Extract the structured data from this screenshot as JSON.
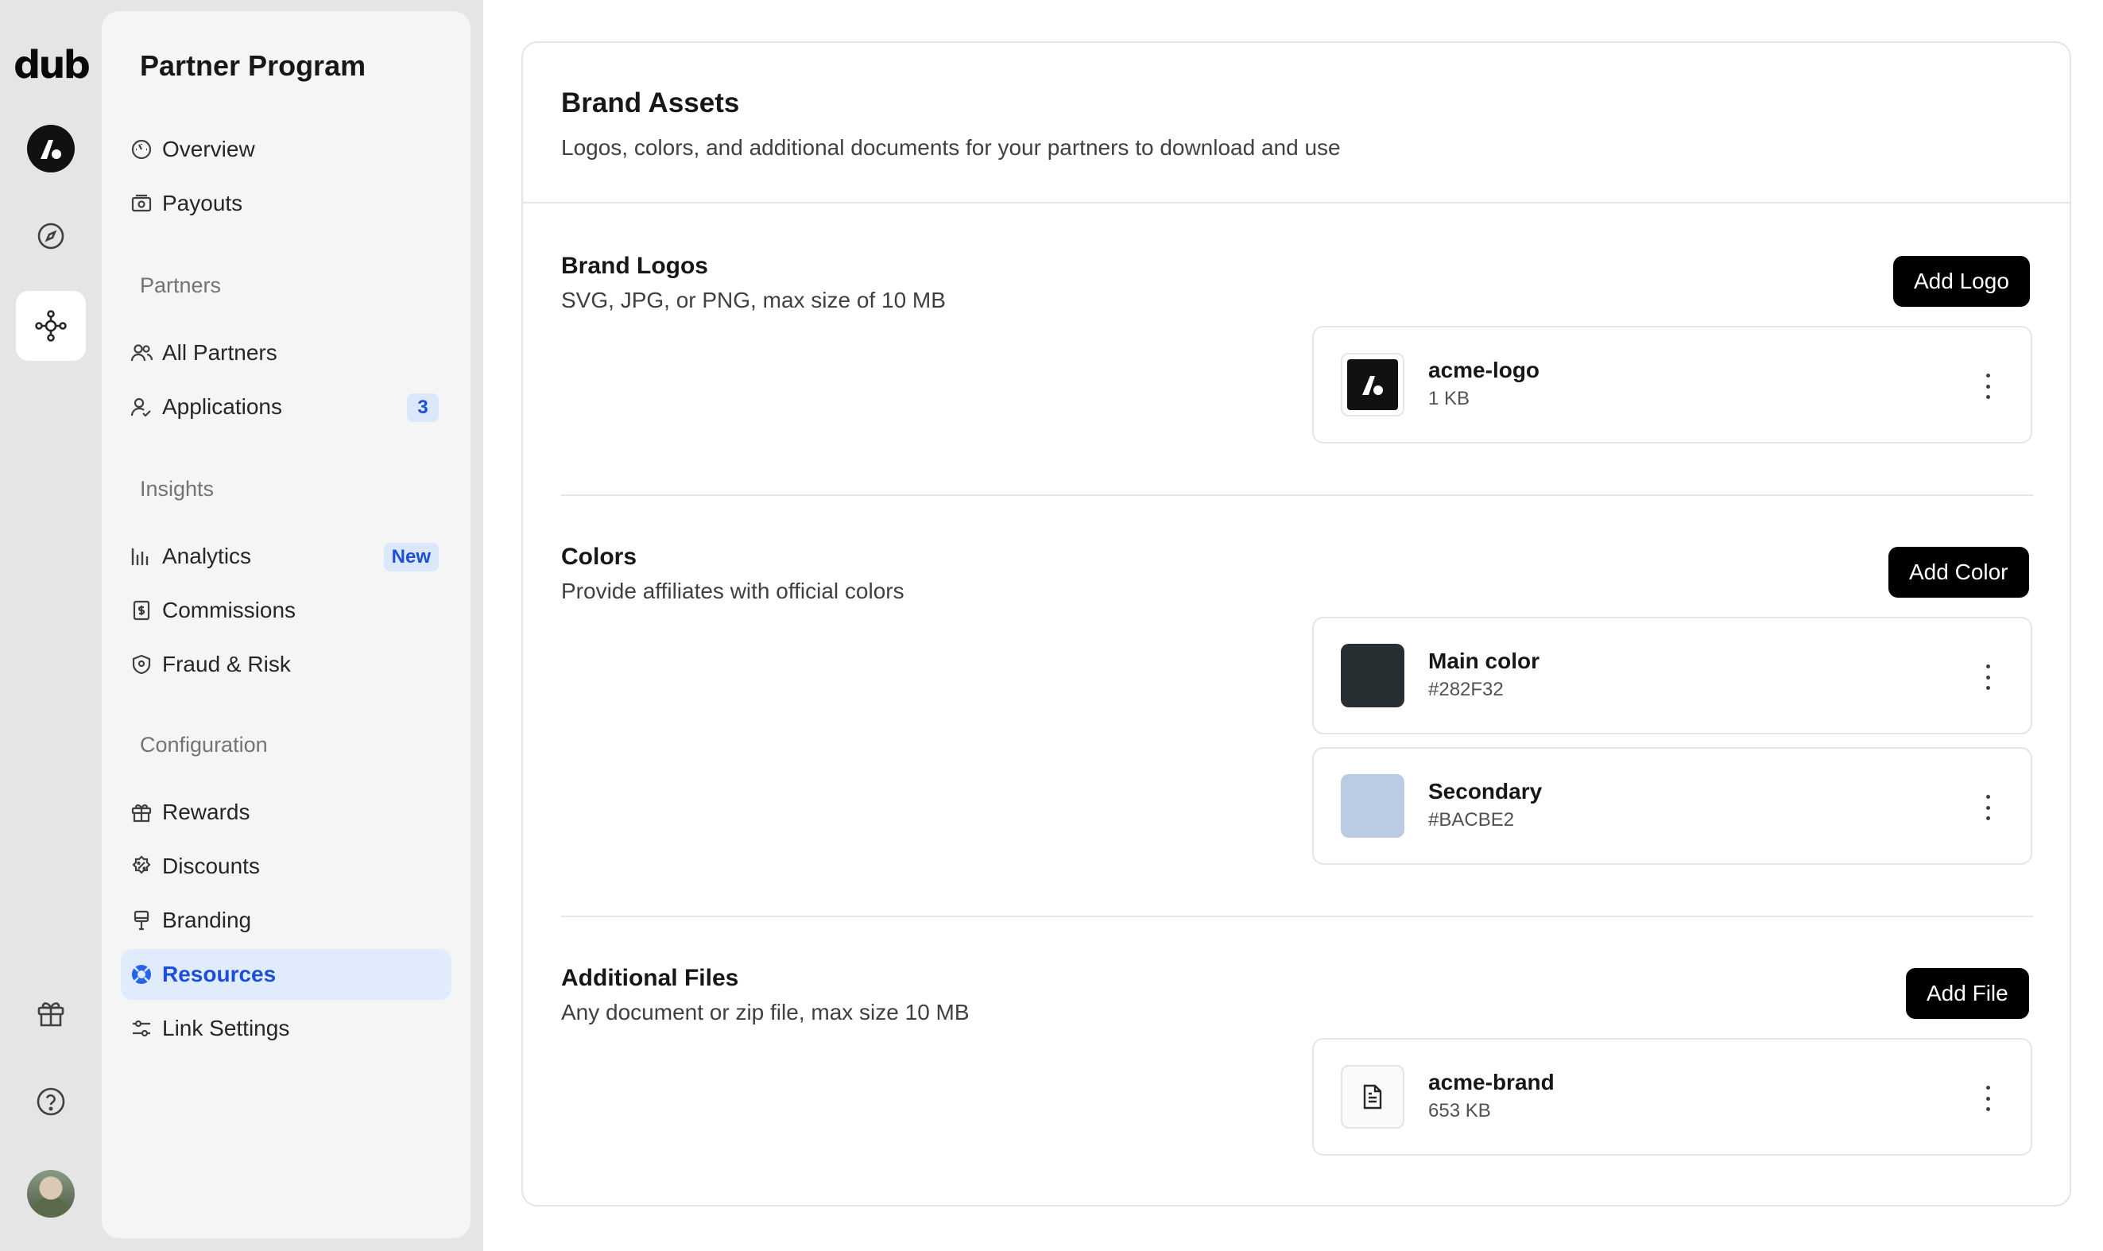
{
  "rail": {
    "logo": "dub"
  },
  "sidebar": {
    "title": "Partner Program",
    "top_items": [
      {
        "label": "Overview",
        "icon": "gauge-icon"
      },
      {
        "label": "Payouts",
        "icon": "money-icon"
      }
    ],
    "sections": [
      {
        "title": "Partners",
        "items": [
          {
            "label": "All Partners",
            "icon": "users-icon"
          },
          {
            "label": "Applications",
            "icon": "user-check-icon",
            "badge": "3"
          }
        ]
      },
      {
        "title": "Insights",
        "items": [
          {
            "label": "Analytics",
            "icon": "chart-icon",
            "badge": "New"
          },
          {
            "label": "Commissions",
            "icon": "receipt-icon"
          },
          {
            "label": "Fraud & Risk",
            "icon": "shield-icon"
          }
        ]
      },
      {
        "title": "Configuration",
        "items": [
          {
            "label": "Rewards",
            "icon": "gift-icon"
          },
          {
            "label": "Discounts",
            "icon": "discount-icon"
          },
          {
            "label": "Branding",
            "icon": "paintbrush-icon"
          },
          {
            "label": "Resources",
            "icon": "lifebuoy-icon",
            "active": true
          },
          {
            "label": "Link Settings",
            "icon": "sliders-icon"
          }
        ]
      }
    ]
  },
  "main": {
    "title": "Brand Assets",
    "subtitle": "Logos, colors, and additional documents for your partners to download and use",
    "logos": {
      "title": "Brand Logos",
      "subtitle": "SVG, JPG, or PNG, max size of 10 MB",
      "button": "Add Logo",
      "items": [
        {
          "name": "acme-logo",
          "meta": "1 KB"
        }
      ]
    },
    "colors": {
      "title": "Colors",
      "subtitle": "Provide affiliates with official colors",
      "button": "Add Color",
      "items": [
        {
          "name": "Main color",
          "meta": "#282F32",
          "swatch": "#282F32"
        },
        {
          "name": "Secondary",
          "meta": "#BACBE2",
          "swatch": "#BACBE2"
        }
      ]
    },
    "files": {
      "title": "Additional Files",
      "subtitle": "Any document or zip file, max size 10 MB",
      "button": "Add File",
      "items": [
        {
          "name": "acme-brand",
          "meta": "653 KB"
        }
      ]
    }
  },
  "colors": {
    "accent": "#1D4ED8",
    "active_bg": "#E0EBFB",
    "button_bg": "#000000"
  }
}
